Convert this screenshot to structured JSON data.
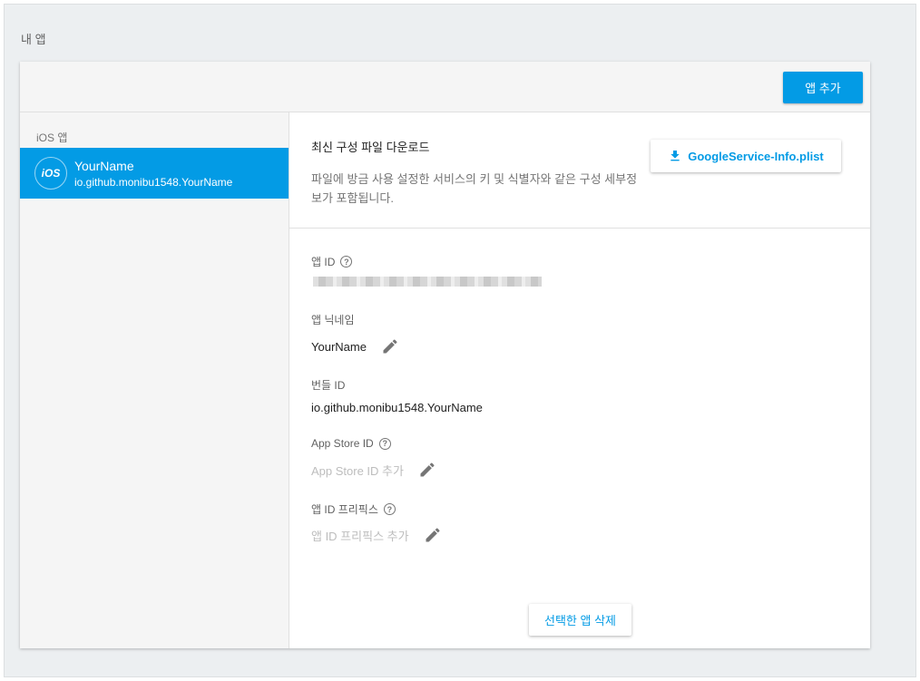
{
  "page": {
    "section_title": "내 앱",
    "add_app_label": "앱 추가"
  },
  "sidebar": {
    "header": "iOS 앱",
    "app": {
      "badge": "iOS",
      "name": "YourName",
      "bundle": "io.github.monibu1548.YourName"
    }
  },
  "download": {
    "title": "최신 구성 파일 다운로드",
    "description": "파일에 방금 사용 설정한 서비스의 키 및 식별자와 같은 구성 세부정보가 포함됩니다.",
    "button_label": "GoogleService-Info.plist"
  },
  "fields": {
    "app_id": {
      "label": "앱 ID"
    },
    "nickname": {
      "label": "앱 닉네임",
      "value": "YourName"
    },
    "bundle_id": {
      "label": "번들 ID",
      "value": "io.github.monibu1548.YourName"
    },
    "app_store_id": {
      "label": "App Store ID",
      "placeholder": "App Store ID 추가"
    },
    "app_id_prefix": {
      "label": "앱 ID 프리픽스",
      "placeholder": "앱 ID 프리픽스 추가"
    }
  },
  "actions": {
    "delete_label": "선택한 앱 삭제"
  },
  "colors": {
    "accent": "#039be5",
    "background": "#eceff1"
  },
  "icons": {
    "help": "help-circle-icon",
    "edit": "pencil-icon",
    "download": "download-icon"
  }
}
